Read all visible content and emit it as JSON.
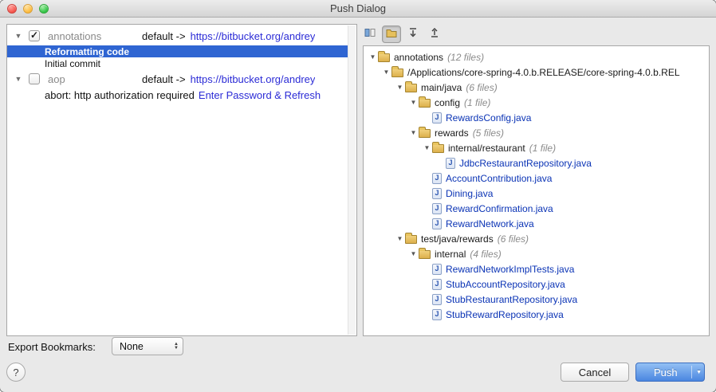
{
  "window": {
    "title": "Push Dialog"
  },
  "colors": {
    "link_blue": "#2b2bd6",
    "file_blue": "#0a33b5",
    "selection_blue": "#2f65d2",
    "push_button_blue": "#4a86e0",
    "folder_yellow": "#ddb04c"
  },
  "icons": {
    "triangle_down": "▼",
    "triangle_up": "▲",
    "check": "✓",
    "java_letter": "J",
    "toolbar": [
      {
        "name": "show-diff-icon",
        "glyph": "css-shape",
        "pressed": false
      },
      {
        "name": "group-by-directory-icon",
        "glyph": "css-shape",
        "pressed": true
      },
      {
        "name": "expand-all-icon",
        "glyph": "css-shape",
        "pressed": false
      },
      {
        "name": "collapse-all-icon",
        "glyph": "css-shape",
        "pressed": false
      }
    ]
  },
  "left_panel": {
    "repos": [
      {
        "name": "annotations",
        "checked": true,
        "branch_text": "default ->",
        "url": "https://bitbucket.org/andrey",
        "commits": [
          {
            "message": "Reformatting code",
            "selected": true
          },
          {
            "message": "Initial commit",
            "selected": false
          }
        ]
      },
      {
        "name": "aop",
        "checked": false,
        "branch_text": "default ->",
        "url": "https://bitbucket.org/andrey",
        "error_text": "abort: http authorization required",
        "error_link": "Enter Password & Refresh"
      }
    ]
  },
  "right_panel": {
    "tree": [
      {
        "label": "annotations",
        "count": "(12 files)",
        "type": "folder",
        "level": 0
      },
      {
        "label": "/Applications/core-spring-4.0.b.RELEASE/core-spring-4.0.b.REL",
        "count": "",
        "type": "folder",
        "level": 1
      },
      {
        "label": "main/java",
        "count": "(6 files)",
        "type": "folder",
        "level": 2
      },
      {
        "label": "config",
        "count": "(1 file)",
        "type": "folder",
        "level": 3
      },
      {
        "label": "RewardsConfig.java",
        "type": "file",
        "level": 4
      },
      {
        "label": "rewards",
        "count": "(5 files)",
        "type": "folder",
        "level": 3
      },
      {
        "label": "internal/restaurant",
        "count": "(1 file)",
        "type": "folder",
        "level": 4
      },
      {
        "label": "JdbcRestaurantRepository.java",
        "type": "file",
        "level": 5
      },
      {
        "label": "AccountContribution.java",
        "type": "file",
        "level": 4
      },
      {
        "label": "Dining.java",
        "type": "file",
        "level": 4
      },
      {
        "label": "RewardConfirmation.java",
        "type": "file",
        "level": 4
      },
      {
        "label": "RewardNetwork.java",
        "type": "file",
        "level": 4
      },
      {
        "label": "test/java/rewards",
        "count": "(6 files)",
        "type": "folder",
        "level": 2
      },
      {
        "label": "internal",
        "count": "(4 files)",
        "type": "folder",
        "level": 3
      },
      {
        "label": "RewardNetworkImplTests.java",
        "type": "file",
        "level": 4
      },
      {
        "label": "StubAccountRepository.java",
        "type": "file",
        "level": 4
      },
      {
        "label": "StubRestaurantRepository.java",
        "type": "file",
        "level": 4
      },
      {
        "label": "StubRewardRepository.java",
        "type": "file",
        "level": 4
      }
    ]
  },
  "footer": {
    "export_bookmarks_label": "Export Bookmarks:",
    "export_bookmarks_value": "None",
    "help_label": "?",
    "cancel_label": "Cancel",
    "push_label": "Push"
  }
}
